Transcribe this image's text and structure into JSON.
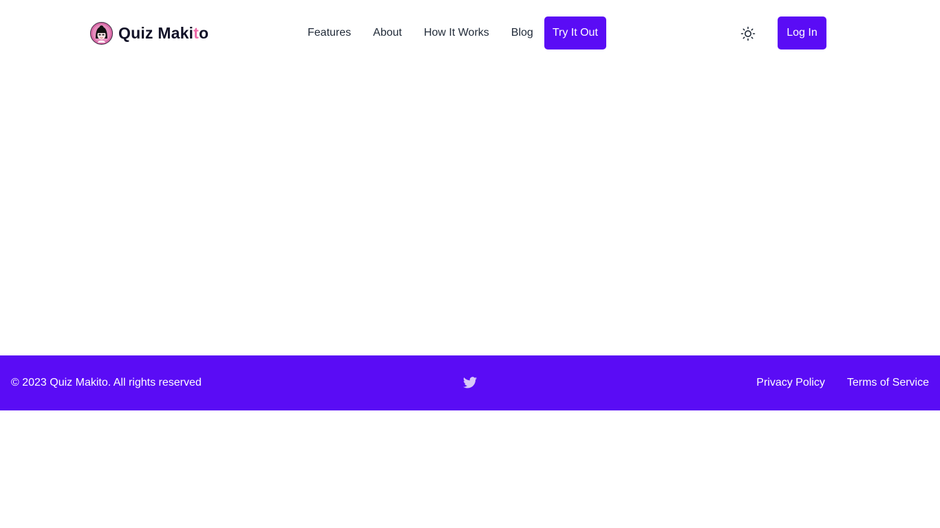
{
  "header": {
    "brand": {
      "name_main": "Quiz Maki",
      "name_accent": "t",
      "name_tail": "o",
      "logo_icon": "girl-avatar-icon"
    },
    "nav": [
      {
        "label": "Features"
      },
      {
        "label": "About"
      },
      {
        "label": "How It Works"
      },
      {
        "label": "Blog"
      }
    ],
    "cta_label": "Try It Out",
    "theme_icon": "sun-icon",
    "login_label": "Log In"
  },
  "footer": {
    "copyright": "© 2023 Quiz Makito. All rights reserved",
    "social_icon": "twitter-icon",
    "links": [
      {
        "label": "Privacy Policy"
      },
      {
        "label": "Terms of Service"
      }
    ]
  },
  "colors": {
    "primary": "#5a0cf5",
    "brand_accent": "#ec6aa8",
    "text_dark": "#111127",
    "background": "#ffffff"
  }
}
